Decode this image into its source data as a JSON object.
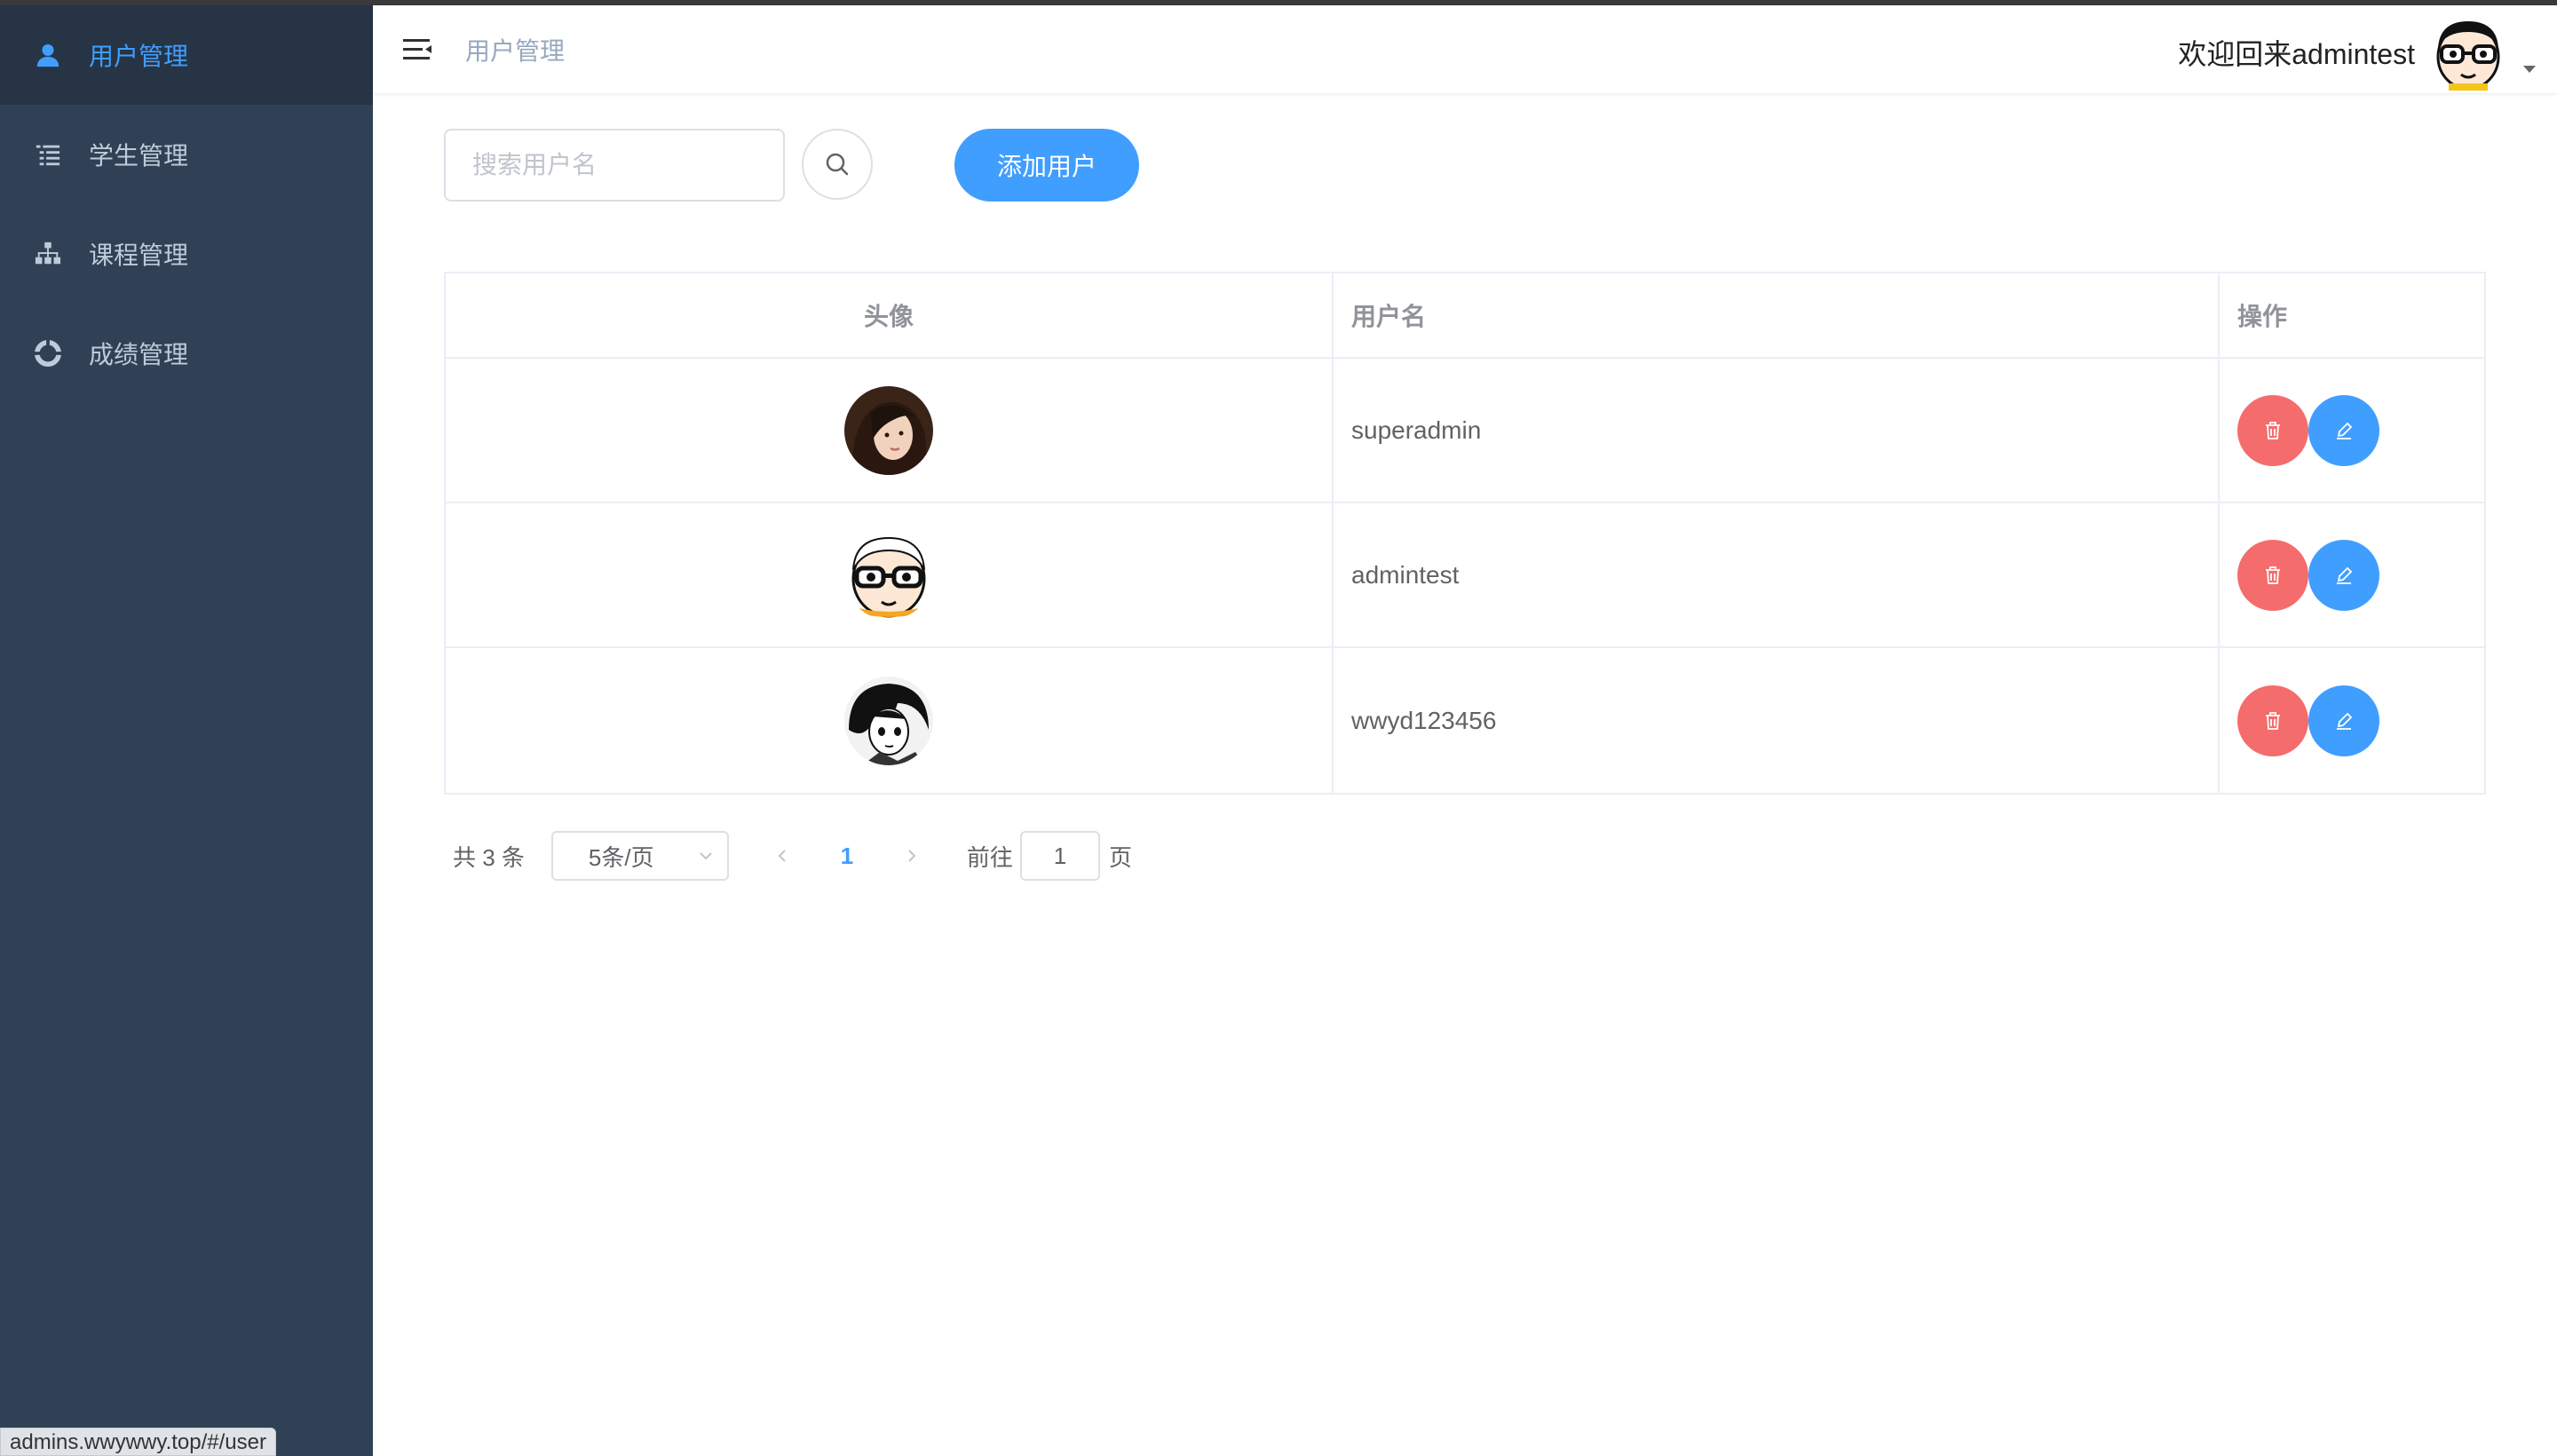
{
  "sidebar": {
    "items": [
      {
        "label": "用户管理",
        "icon": "user-icon",
        "active": true
      },
      {
        "label": "学生管理",
        "icon": "list-icon",
        "active": false
      },
      {
        "label": "课程管理",
        "icon": "tree-icon",
        "active": false
      },
      {
        "label": "成绩管理",
        "icon": "chart-icon",
        "active": false
      }
    ]
  },
  "header": {
    "breadcrumb": "用户管理",
    "welcome": "欢迎回来admintest",
    "avatar": "admintest-avatar"
  },
  "toolbar": {
    "search_placeholder": "搜索用户名",
    "add_label": "添加用户"
  },
  "table": {
    "columns": [
      "头像",
      "用户名",
      "操作"
    ],
    "rows": [
      {
        "username": "superadmin",
        "avatar": "girl-photo"
      },
      {
        "username": "admintest",
        "avatar": "glasses-cartoon"
      },
      {
        "username": "wwyd123456",
        "avatar": "anime-sketch"
      }
    ]
  },
  "pagination": {
    "total_label": "共 3 条",
    "page_size_label": "5条/页",
    "current_page": "1",
    "goto_label": "前往",
    "goto_value": "1",
    "page_suffix": "页"
  },
  "statusbar": {
    "url": "admins.wwywwy.top/#/user"
  },
  "colors": {
    "sidebar_bg": "#304156",
    "sidebar_active_bg": "#263445",
    "primary": "#409eff",
    "danger": "#f56c6c"
  }
}
